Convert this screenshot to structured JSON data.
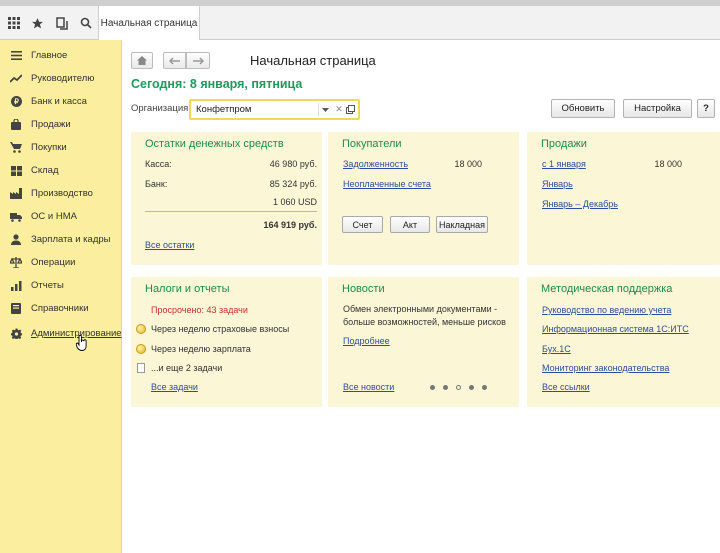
{
  "tab": {
    "label": "Начальная страница"
  },
  "sidebar": {
    "items": [
      {
        "label": "Главное",
        "icon": "list-icon"
      },
      {
        "label": "Руководителю",
        "icon": "trend-icon"
      },
      {
        "label": "Банк и касса",
        "icon": "coin-icon"
      },
      {
        "label": "Продажи",
        "icon": "bag-icon"
      },
      {
        "label": "Покупки",
        "icon": "cart-icon"
      },
      {
        "label": "Склад",
        "icon": "warehouse-icon"
      },
      {
        "label": "Производство",
        "icon": "factory-icon"
      },
      {
        "label": "ОС и НМА",
        "icon": "truck-icon"
      },
      {
        "label": "Зарплата и кадры",
        "icon": "person-icon"
      },
      {
        "label": "Операции",
        "icon": "scales-icon"
      },
      {
        "label": "Отчеты",
        "icon": "chart-icon"
      },
      {
        "label": "Справочники",
        "icon": "book-icon"
      },
      {
        "label": "Администрирование",
        "icon": "gear-icon"
      }
    ]
  },
  "header": {
    "title": "Начальная страница",
    "today": "Сегодня: 8 января, пятница",
    "org_label": "Организация:",
    "org_value": "Конфетпром",
    "refresh_label": "Обновить",
    "settings_label": "Настройка",
    "help_label": "?"
  },
  "cash": {
    "title": "Остатки денежных средств",
    "kassa_label": "Касса:",
    "kassa_value": "46 980 руб.",
    "bank_label": "Банк:",
    "bank_value": "85 324 руб.",
    "usd_value": "1 060 USD",
    "total_value": "164 919 руб.",
    "all_link": "Все остатки"
  },
  "buyers": {
    "title": "Покупатели",
    "debt_link": "Задолженность",
    "debt_value": "18 000",
    "unpaid_link": "Неоплаченные счета",
    "btn_invoice": "Счет",
    "btn_act": "Акт",
    "btn_waybill": "Накладная"
  },
  "sales": {
    "title": "Продажи",
    "from_link": "с 1 января",
    "from_value": "18 000",
    "january_link": "Январь",
    "range_link": "Январь – Декабрь"
  },
  "taxes": {
    "title": "Налоги и отчеты",
    "overdue": "Просрочено: 43 задачи",
    "item1": "Через неделю страховые взносы",
    "item2": "Через неделю зарплата",
    "item3": "...и еще 2 задачи",
    "all_link": "Все задачи"
  },
  "news": {
    "title": "Новости",
    "line1": "Обмен электронными документами -",
    "line2": "больше возможностей, меньше рисков",
    "more_link": "Подробнее",
    "all_link": "Все новости"
  },
  "support": {
    "title": "Методическая поддержка",
    "link1": "Руководство по ведению учета",
    "link2": "Информационная система 1С:ИТС",
    "link3": "Бух.1С",
    "link4": "Мониторинг законодательства",
    "all_link": "Все ссылки"
  }
}
